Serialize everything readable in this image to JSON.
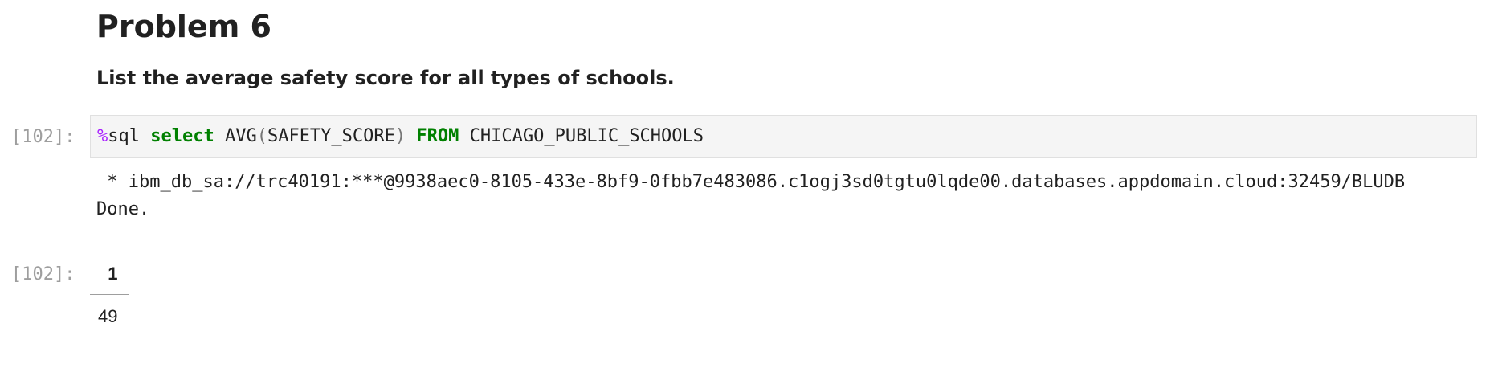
{
  "markdown": {
    "heading": "Problem 6",
    "paragraph": "List the average safety score for all types of schools."
  },
  "input_cell": {
    "prompt": "[102]:",
    "code_tokens": [
      {
        "text": "%",
        "kind": "magic"
      },
      {
        "text": "sql ",
        "kind": "plain"
      },
      {
        "text": "select",
        "kind": "kw"
      },
      {
        "text": " AVG",
        "kind": "plain"
      },
      {
        "text": "(",
        "kind": "paren"
      },
      {
        "text": "SAFETY_SCORE",
        "kind": "plain"
      },
      {
        "text": ")",
        "kind": "paren"
      },
      {
        "text": " ",
        "kind": "plain"
      },
      {
        "text": "FROM",
        "kind": "kw"
      },
      {
        "text": " CHICAGO_PUBLIC_SCHOOLS",
        "kind": "plain"
      }
    ]
  },
  "stdout": {
    "connection_line": " * ibm_db_sa://trc40191:***@9938aec0-8105-433e-8bf9-0fbb7e483086.c1ogj3sd0tgtu0lqde00.databases.appdomain.cloud:32459/BLUDB",
    "status_line": "Done."
  },
  "output_cell": {
    "prompt": "[102]:",
    "table": {
      "columns": [
        "1"
      ],
      "rows": [
        [
          "49"
        ]
      ]
    }
  },
  "colors": {
    "magic": "#aa22ff",
    "keyword": "#008000",
    "prompt": "#9e9e9e",
    "code_bg": "#f5f5f5"
  }
}
